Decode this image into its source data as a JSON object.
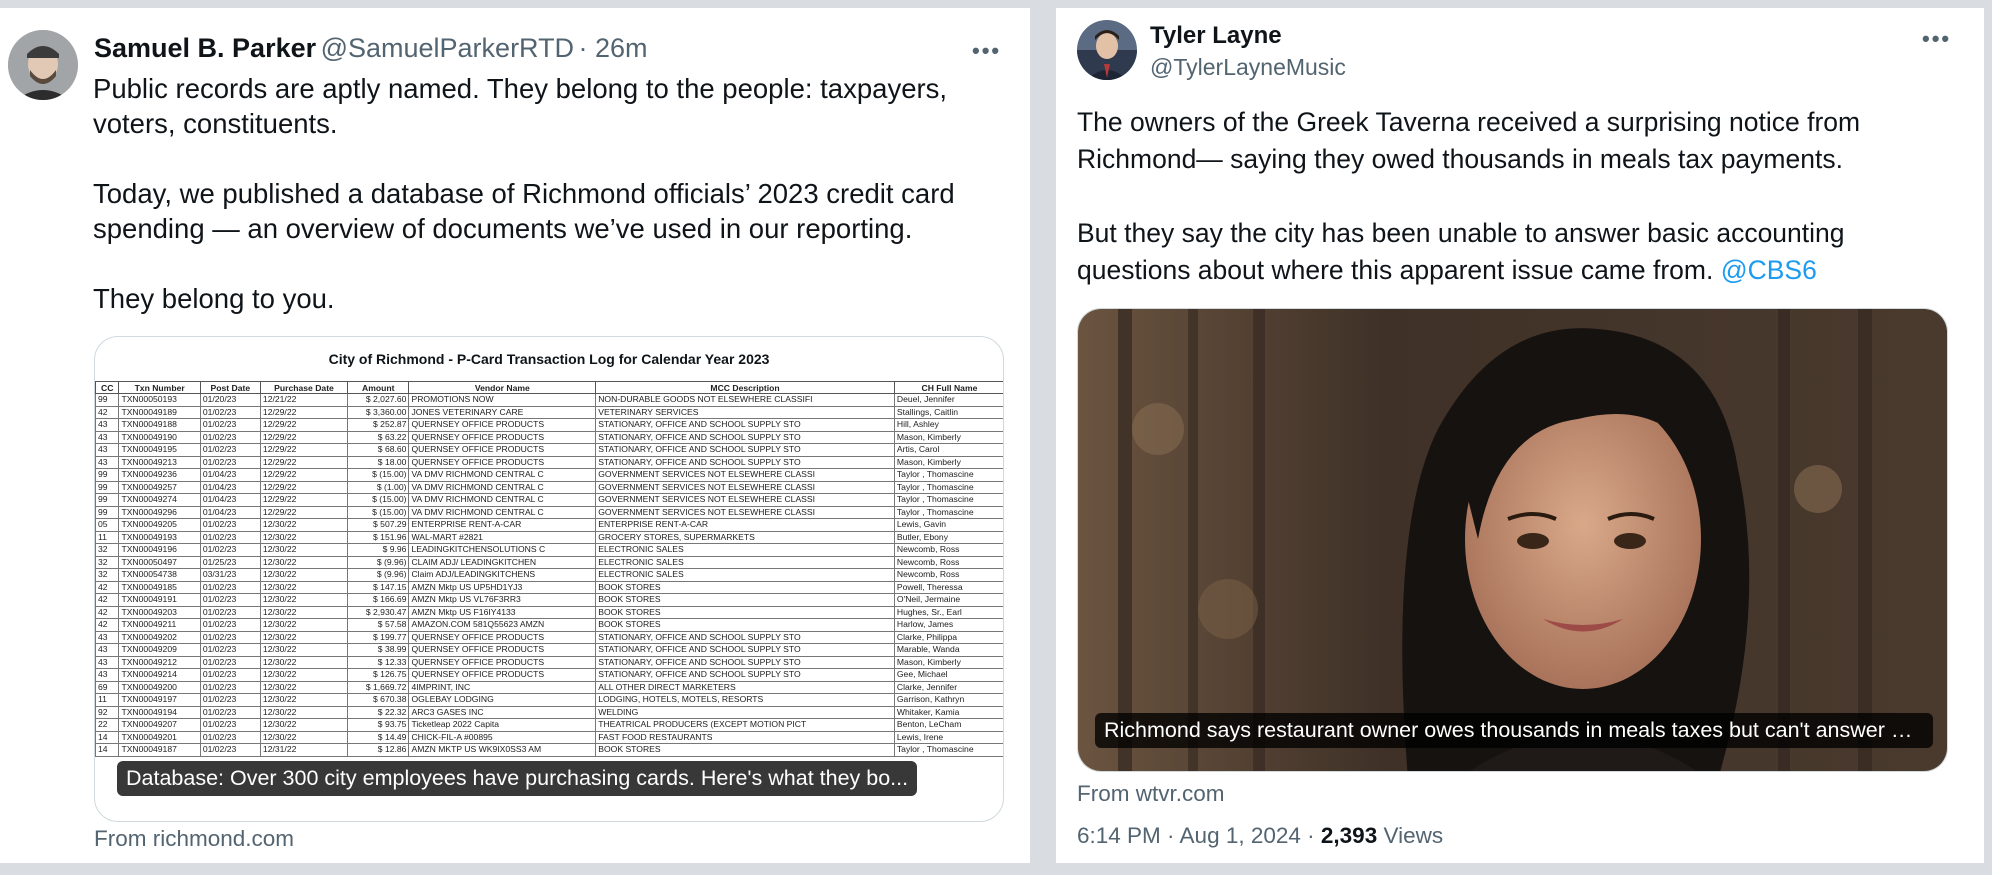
{
  "left_tweet": {
    "author_name": "Samuel B. Parker",
    "handle": "@SamuelParkerRTD",
    "time": "· 26m",
    "more_label": "•••",
    "text": "Public records are aptly named. They belong to the people: taxpayers,\nvoters, constituents.\n\nToday, we published a database of Richmond officials’ 2023 credit card\nspending — an overview of documents we’ve used in our reporting.\n\nThey belong to you.",
    "card": {
      "table_title": "City of Richmond - P-Card Transaction Log for Calendar Year 2023",
      "headers": [
        "CC",
        "Txn Number",
        "Post Date",
        "Purchase Date",
        "Amount",
        "Vendor Name",
        "MCC Description",
        "CH Full Name"
      ],
      "rows": [
        [
          "99",
          "TXN00050193",
          "01/20/23",
          "12/21/22",
          "$  2,027.60",
          "PROMOTIONS NOW",
          "NON-DURABLE GOODS NOT ELSEWHERE CLASSIFI",
          "Deuel, Jennifer"
        ],
        [
          "42",
          "TXN00049189",
          "01/02/23",
          "12/29/22",
          "$  3,360.00",
          "JONES VETERINARY CARE",
          "VETERINARY SERVICES",
          "Stallings, Caitlin"
        ],
        [
          "43",
          "TXN00049188",
          "01/02/23",
          "12/29/22",
          "$  252.87",
          "QUERNSEY OFFICE PRODUCTS",
          "STATIONARY, OFFICE AND SCHOOL SUPPLY STO",
          "Hill, Ashley"
        ],
        [
          "43",
          "TXN00049190",
          "01/02/23",
          "12/29/22",
          "$  63.22",
          "QUERNSEY OFFICE PRODUCTS",
          "STATIONARY, OFFICE AND SCHOOL SUPPLY STO",
          "Mason, Kimberly"
        ],
        [
          "43",
          "TXN00049195",
          "01/02/23",
          "12/29/22",
          "$  68.60",
          "QUERNSEY OFFICE PRODUCTS",
          "STATIONARY, OFFICE AND SCHOOL SUPPLY STO",
          "Artis, Carol"
        ],
        [
          "43",
          "TXN00049213",
          "01/02/23",
          "12/29/22",
          "$  18.00",
          "QUERNSEY OFFICE PRODUCTS",
          "STATIONARY, OFFICE AND SCHOOL SUPPLY STO",
          "Mason, Kimberly"
        ],
        [
          "99",
          "TXN00049236",
          "01/04/23",
          "12/29/22",
          "$  (15.00)",
          "VA DMV RICHMOND CENTRAL C",
          "GOVERNMENT SERVICES NOT ELSEWHERE CLASSI",
          "Taylor , Thomascine"
        ],
        [
          "99",
          "TXN00049257",
          "01/04/23",
          "12/29/22",
          "$  (1.00)",
          "VA DMV RICHMOND CENTRAL C",
          "GOVERNMENT SERVICES NOT ELSEWHERE CLASSI",
          "Taylor , Thomascine"
        ],
        [
          "99",
          "TXN00049274",
          "01/04/23",
          "12/29/22",
          "$  (15.00)",
          "VA DMV RICHMOND CENTRAL C",
          "GOVERNMENT SERVICES NOT ELSEWHERE CLASSI",
          "Taylor , Thomascine"
        ],
        [
          "99",
          "TXN00049296",
          "01/04/23",
          "12/29/22",
          "$  (15.00)",
          "VA DMV RICHMOND CENTRAL C",
          "GOVERNMENT SERVICES NOT ELSEWHERE CLASSI",
          "Taylor , Thomascine"
        ],
        [
          "05",
          "TXN00049205",
          "01/02/23",
          "12/30/22",
          "$  507.29",
          "ENTERPRISE RENT-A-CAR",
          "ENTERPRISE RENT-A-CAR",
          "Lewis, Gavin"
        ],
        [
          "11",
          "TXN00049193",
          "01/02/23",
          "12/30/22",
          "$  151.96",
          "WAL-MART #2821",
          "GROCERY STORES, SUPERMARKETS",
          "Butler, Ebony"
        ],
        [
          "32",
          "TXN00049196",
          "01/02/23",
          "12/30/22",
          "$  9.96",
          "LEADINGKITCHENSOLUTIONS C",
          "ELECTRONIC SALES",
          "Newcomb, Ross"
        ],
        [
          "32",
          "TXN00050497",
          "01/25/23",
          "12/30/22",
          "$  (9.96)",
          "CLAIM ADJ/ LEADINGKITCHEN",
          "ELECTRONIC SALES",
          "Newcomb, Ross"
        ],
        [
          "32",
          "TXN00054738",
          "03/31/23",
          "12/30/22",
          "$  (9.96)",
          "Claim ADJ/LEADINGKITCHENS",
          "ELECTRONIC SALES",
          "Newcomb, Ross"
        ],
        [
          "42",
          "TXN00049185",
          "01/02/23",
          "12/30/22",
          "$  147.15",
          "AMZN Mktp US UP5HD1YJ3",
          "BOOK STORES",
          "Powell, Theressa"
        ],
        [
          "42",
          "TXN00049191",
          "01/02/23",
          "12/30/22",
          "$  166.69",
          "AMZN Mktp US VL76F3RR3",
          "BOOK STORES",
          "O'Neil, Jermaine"
        ],
        [
          "42",
          "TXN00049203",
          "01/02/23",
          "12/30/22",
          "$  2,930.47",
          "AMZN Mktp US F16IY4133",
          "BOOK STORES",
          "Hughes, Sr., Earl"
        ],
        [
          "42",
          "TXN00049211",
          "01/02/23",
          "12/30/22",
          "$  57.58",
          "AMAZON.COM 581Q55623 AMZN",
          "BOOK STORES",
          "Harlow, James"
        ],
        [
          "43",
          "TXN00049202",
          "01/02/23",
          "12/30/22",
          "$  199.77",
          "QUERNSEY OFFICE PRODUCTS",
          "STATIONARY, OFFICE AND SCHOOL SUPPLY STO",
          "Clarke, Philippa"
        ],
        [
          "43",
          "TXN00049209",
          "01/02/23",
          "12/30/22",
          "$  38.99",
          "QUERNSEY OFFICE PRODUCTS",
          "STATIONARY, OFFICE AND SCHOOL SUPPLY STO",
          "Marable, Wanda"
        ],
        [
          "43",
          "TXN00049212",
          "01/02/23",
          "12/30/22",
          "$  12.33",
          "QUERNSEY OFFICE PRODUCTS",
          "STATIONARY, OFFICE AND SCHOOL SUPPLY STO",
          "Mason, Kimberly"
        ],
        [
          "43",
          "TXN00049214",
          "01/02/23",
          "12/30/22",
          "$  126.75",
          "QUERNSEY OFFICE PRODUCTS",
          "STATIONARY, OFFICE AND SCHOOL SUPPLY STO",
          "Gee, Michael"
        ],
        [
          "69",
          "TXN00049200",
          "01/02/23",
          "12/30/22",
          "$  1,669.72",
          "4IMPRINT, INC",
          "ALL OTHER DIRECT MARKETERS",
          "Clarke, Jennifer"
        ],
        [
          "11",
          "TXN00049197",
          "01/02/23",
          "12/30/22",
          "$  670.38",
          "OGLEBAY LODGING",
          "LODGING, HOTELS, MOTELS, RESORTS",
          "Garrison, Kathryn"
        ],
        [
          "92",
          "TXN00049194",
          "01/02/23",
          "12/30/22",
          "$  22.32",
          "ARC3 GASES INC",
          "WELDING",
          "Whitaker, Kamia"
        ],
        [
          "22",
          "TXN00049207",
          "01/02/23",
          "12/30/22",
          "$  93.75",
          "Ticketleap 2022 Capita",
          "THEATRICAL PRODUCERS (EXCEPT MOTION PICT",
          "Benton, LeCham"
        ],
        [
          "14",
          "TXN00049201",
          "01/02/23",
          "12/30/22",
          "$  14.49",
          "CHICK-FIL-A #00895",
          "FAST FOOD RESTAURANTS",
          "Lewis, Irene"
        ],
        [
          "14",
          "TXN00049187",
          "01/02/23",
          "12/31/22",
          "$  12.86",
          "AMZN MKTP US WK9IX0SS3 AM",
          "BOOK STORES",
          "Taylor , Thomascine"
        ]
      ],
      "caption": "Database: Over 300 city employees have purchasing cards. Here's what they bo...",
      "source": "From richmond.com"
    }
  },
  "right_tweet": {
    "author_name": "Tyler Layne",
    "handle": "@TylerLayneMusic",
    "more_label": "•••",
    "text": "The owners of the Greek Taverna received a surprising notice from\nRichmond— saying they owed thousands in meals tax payments.\n\nBut they say the city has been unable to answer basic accounting\nquestions about where this apparent issue came from. ",
    "mention": "@CBS6",
    "card": {
      "caption": "Richmond says restaurant owner owes thousands in meals taxes but can't answer her q...",
      "source": "From wtvr.com"
    },
    "meta": {
      "time_date": "6:14 PM · Aug 1, 2024 · ",
      "views_count": "2,393",
      "views_label": " Views"
    }
  },
  "colors": {
    "accent": "#1d9bf0",
    "secondary_text": "#536471",
    "background": "#d9dce0"
  }
}
